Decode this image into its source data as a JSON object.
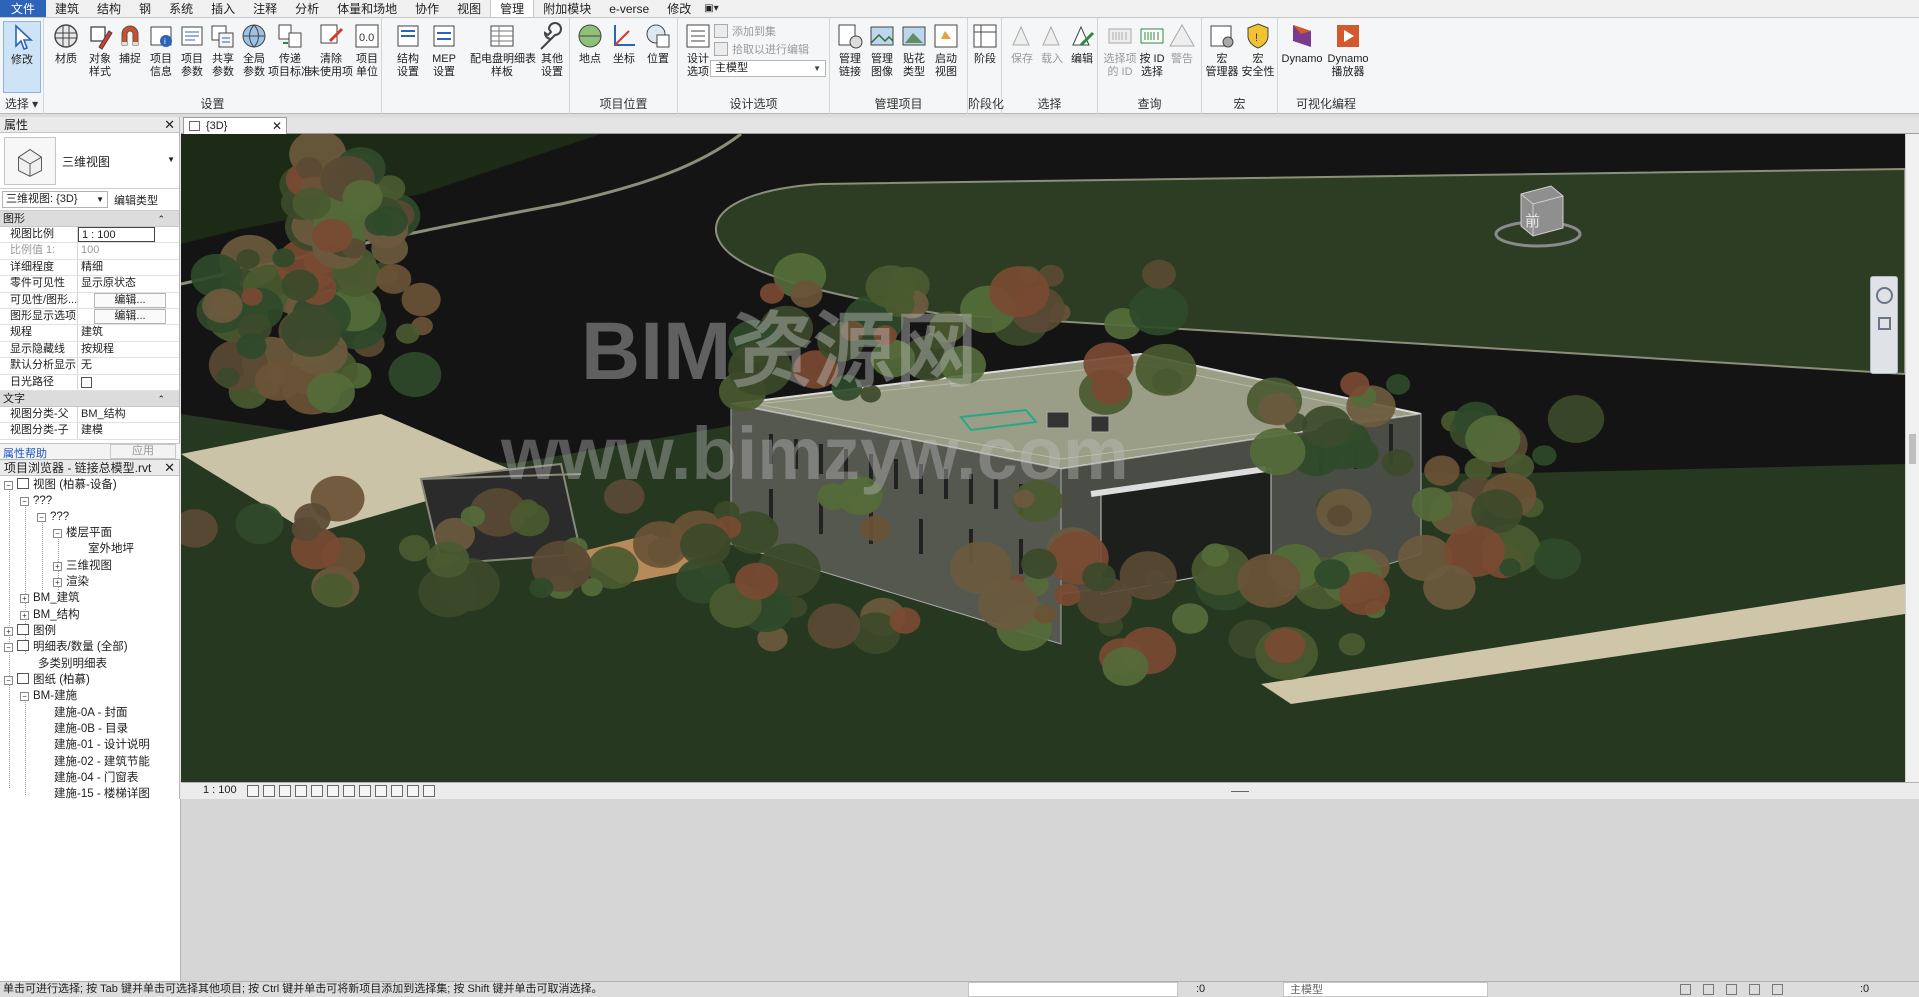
{
  "menu": {
    "tabs": [
      "文件",
      "建筑",
      "结构",
      "钢",
      "系统",
      "插入",
      "注释",
      "分析",
      "体量和场地",
      "协作",
      "视图",
      "管理",
      "附加模块",
      "e-verse",
      "修改"
    ],
    "active": "管理",
    "quick_access": "▣▾"
  },
  "ribbon": {
    "select_group": {
      "modify": "修改",
      "select": "选择"
    },
    "settings": {
      "title": "设置",
      "buttons": [
        "材质",
        "对象\n样式",
        "捕捉",
        "项目\n信息",
        "项目\n参数",
        "共享\n参数",
        "全局\n参数",
        "传递\n项目标准",
        "清除\n未使用项",
        "项目\n单位"
      ]
    },
    "mep": {
      "buttons": [
        "结构\n设置",
        "MEP\n设置",
        "配电盘明细表\n样板",
        "其他\n设置"
      ]
    },
    "location": {
      "title": "项目位置",
      "buttons": [
        "地点",
        "坐标",
        "位置"
      ]
    },
    "design_options": {
      "title": "设计选项",
      "button": "设计\n选项",
      "add_to_set": "添加到集",
      "pick_to_edit": "拾取以进行编辑",
      "main_model": "主模型"
    },
    "manage_project": {
      "title": "管理项目",
      "buttons": [
        "管理\n链接",
        "管理\n图像",
        "贴花\n类型",
        "启动\n视图"
      ]
    },
    "phasing": {
      "title": "阶段化",
      "button": "阶段"
    },
    "selection": {
      "title": "选择",
      "buttons": [
        "保存",
        "载入",
        "编辑"
      ]
    },
    "inquiry": {
      "title": "查询",
      "buttons": [
        "选择项\n的 ID",
        "按 ID\n选择",
        "警告"
      ]
    },
    "macros": {
      "title": "宏",
      "buttons": [
        "宏\n管理器",
        "宏\n安全性"
      ]
    },
    "visual_programming": {
      "title": "可视化编程",
      "buttons": [
        "Dynamo",
        "Dynamo\n播放器"
      ]
    }
  },
  "properties": {
    "title": "属性",
    "type_name": "三维视图",
    "instance_selector": "三维视图: {3D}",
    "edit_type": "编辑类型",
    "section_graphics": "图形",
    "section_text": "文字",
    "rows": [
      {
        "k": "视图比例",
        "v": "1 : 100"
      },
      {
        "k": "比例值 1:",
        "v": "100"
      },
      {
        "k": "详细程度",
        "v": "精细"
      },
      {
        "k": "零件可见性",
        "v": "显示原状态"
      },
      {
        "k": "可见性/图形...",
        "v": "编辑..."
      },
      {
        "k": "图形显示选项",
        "v": "编辑..."
      },
      {
        "k": "规程",
        "v": "建筑"
      },
      {
        "k": "显示隐藏线",
        "v": "按规程"
      },
      {
        "k": "默认分析显示...",
        "v": "无"
      },
      {
        "k": "日光路径",
        "v": ""
      }
    ],
    "text_rows": [
      {
        "k": "视图分类-父",
        "v": "BM_结构"
      },
      {
        "k": "视图分类-子",
        "v": "建模"
      }
    ],
    "help": "属性帮助",
    "apply": "应用"
  },
  "browser": {
    "title": "项目浏览器 - 链接总模型.rvt",
    "nodes": [
      "视图 (柏慕-设备)",
      "???",
      "???",
      "楼层平面",
      "室外地坪",
      "三维视图",
      "渲染",
      "BM_建筑",
      "BM_结构",
      "图例",
      "明细表/数量 (全部)",
      "多类别明细表",
      "图纸 (柏慕)",
      "BM-建施",
      "建施-0A - 封面",
      "建施-0B - 目录",
      "建施-01 - 设计说明",
      "建施-02 - 建筑节能",
      "建施-04 - 门窗表",
      "建施-15 - 楼梯详图"
    ]
  },
  "view": {
    "tab": "{3D}",
    "cube_face": "前",
    "watermark_1": "BIM资源网",
    "watermark_2": "www.bimzyw.com"
  },
  "view_control": {
    "scale": "1 : 100"
  },
  "status": {
    "message": "单击可进行选择; 按 Tab 键并单击可选择其他项目; 按 Ctrl 键并单击可将新项目添加到选择集; 按 Shift 键并单击可取消选择。",
    "count": ":0",
    "model": "主模型",
    "filter": ":0"
  },
  "colors": {
    "file_tab": "#2b64b8",
    "viewport_bg": "#141414",
    "grass": "#2a3a1e",
    "roof": "#9a9e86",
    "walls": "#5a5d52",
    "highlight": "#22aa88"
  }
}
